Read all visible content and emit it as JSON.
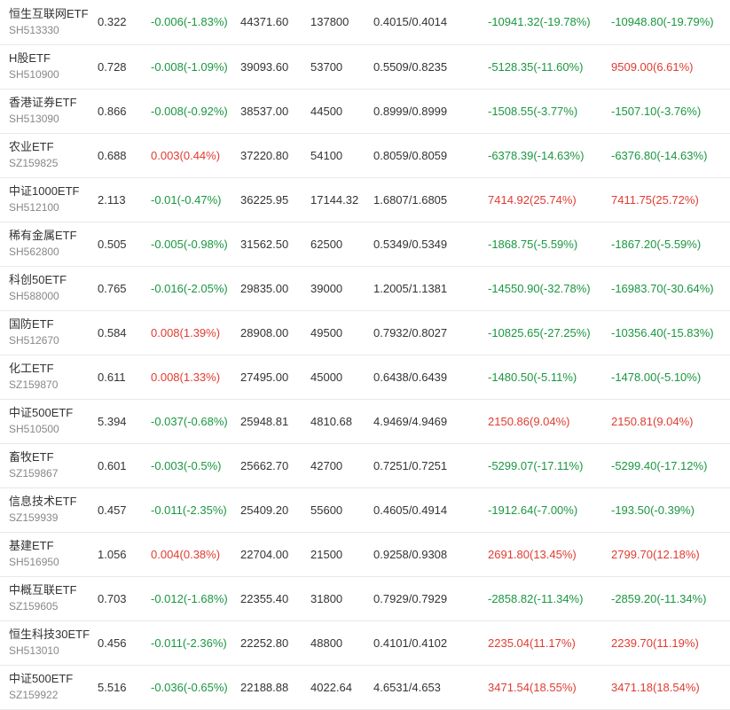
{
  "colors": {
    "up": "#e03c31",
    "down": "#1a9740",
    "neutral": "#333333",
    "code": "#888888"
  },
  "rows": [
    {
      "name": "恒生互联网ETF",
      "code": "SH513330",
      "price": "0.322",
      "change": "-0.006(-1.83%)",
      "amount": "44371.60",
      "volume": "137800",
      "range": "0.4015/0.4014",
      "profit": "-10941.32(-19.78%)",
      "profit2": "-10948.80(-19.79%)",
      "c_change": "down",
      "c_profit": "down",
      "c_profit2": "down"
    },
    {
      "name": "H股ETF",
      "code": "SH510900",
      "price": "0.728",
      "change": "-0.008(-1.09%)",
      "amount": "39093.60",
      "volume": "53700",
      "range": "0.5509/0.8235",
      "profit": "-5128.35(-11.60%)",
      "profit2": "9509.00(6.61%)",
      "c_change": "down",
      "c_profit": "down",
      "c_profit2": "up"
    },
    {
      "name": "香港证券ETF",
      "code": "SH513090",
      "price": "0.866",
      "change": "-0.008(-0.92%)",
      "amount": "38537.00",
      "volume": "44500",
      "range": "0.8999/0.8999",
      "profit": "-1508.55(-3.77%)",
      "profit2": "-1507.10(-3.76%)",
      "c_change": "down",
      "c_profit": "down",
      "c_profit2": "down"
    },
    {
      "name": "农业ETF",
      "code": "SZ159825",
      "price": "0.688",
      "change": "0.003(0.44%)",
      "amount": "37220.80",
      "volume": "54100",
      "range": "0.8059/0.8059",
      "profit": "-6378.39(-14.63%)",
      "profit2": "-6376.80(-14.63%)",
      "c_change": "up",
      "c_profit": "down",
      "c_profit2": "down"
    },
    {
      "name": "中证1000ETF",
      "code": "SH512100",
      "price": "2.113",
      "change": "-0.01(-0.47%)",
      "amount": "36225.95",
      "volume": "17144.32",
      "range": "1.6807/1.6805",
      "profit": "7414.92(25.74%)",
      "profit2": "7411.75(25.72%)",
      "c_change": "down",
      "c_profit": "up",
      "c_profit2": "up"
    },
    {
      "name": "稀有金属ETF",
      "code": "SH562800",
      "price": "0.505",
      "change": "-0.005(-0.98%)",
      "amount": "31562.50",
      "volume": "62500",
      "range": "0.5349/0.5349",
      "profit": "-1868.75(-5.59%)",
      "profit2": "-1867.20(-5.59%)",
      "c_change": "down",
      "c_profit": "down",
      "c_profit2": "down"
    },
    {
      "name": "科创50ETF",
      "code": "SH588000",
      "price": "0.765",
      "change": "-0.016(-2.05%)",
      "amount": "29835.00",
      "volume": "39000",
      "range": "1.2005/1.1381",
      "profit": "-14550.90(-32.78%)",
      "profit2": "-16983.70(-30.64%)",
      "c_change": "down",
      "c_profit": "down",
      "c_profit2": "down"
    },
    {
      "name": "国防ETF",
      "code": "SH512670",
      "price": "0.584",
      "change": "0.008(1.39%)",
      "amount": "28908.00",
      "volume": "49500",
      "range": "0.7932/0.8027",
      "profit": "-10825.65(-27.25%)",
      "profit2": "-10356.40(-15.83%)",
      "c_change": "up",
      "c_profit": "down",
      "c_profit2": "down"
    },
    {
      "name": "化工ETF",
      "code": "SZ159870",
      "price": "0.611",
      "change": "0.008(1.33%)",
      "amount": "27495.00",
      "volume": "45000",
      "range": "0.6438/0.6439",
      "profit": "-1480.50(-5.11%)",
      "profit2": "-1478.00(-5.10%)",
      "c_change": "up",
      "c_profit": "down",
      "c_profit2": "down"
    },
    {
      "name": "中证500ETF",
      "code": "SH510500",
      "price": "5.394",
      "change": "-0.037(-0.68%)",
      "amount": "25948.81",
      "volume": "4810.68",
      "range": "4.9469/4.9469",
      "profit": "2150.86(9.04%)",
      "profit2": "2150.81(9.04%)",
      "c_change": "down",
      "c_profit": "up",
      "c_profit2": "up"
    },
    {
      "name": "畜牧ETF",
      "code": "SZ159867",
      "price": "0.601",
      "change": "-0.003(-0.5%)",
      "amount": "25662.70",
      "volume": "42700",
      "range": "0.7251/0.7251",
      "profit": "-5299.07(-17.11%)",
      "profit2": "-5299.40(-17.12%)",
      "c_change": "down",
      "c_profit": "down",
      "c_profit2": "down"
    },
    {
      "name": "信息技术ETF",
      "code": "SZ159939",
      "price": "0.457",
      "change": "-0.011(-2.35%)",
      "amount": "25409.20",
      "volume": "55600",
      "range": "0.4605/0.4914",
      "profit": "-1912.64(-7.00%)",
      "profit2": "-193.50(-0.39%)",
      "c_change": "down",
      "c_profit": "down",
      "c_profit2": "down"
    },
    {
      "name": "基建ETF",
      "code": "SH516950",
      "price": "1.056",
      "change": "0.004(0.38%)",
      "amount": "22704.00",
      "volume": "21500",
      "range": "0.9258/0.9308",
      "profit": "2691.80(13.45%)",
      "profit2": "2799.70(12.18%)",
      "c_change": "up",
      "c_profit": "up",
      "c_profit2": "up"
    },
    {
      "name": "中概互联ETF",
      "code": "SZ159605",
      "price": "0.703",
      "change": "-0.012(-1.68%)",
      "amount": "22355.40",
      "volume": "31800",
      "range": "0.7929/0.7929",
      "profit": "-2858.82(-11.34%)",
      "profit2": "-2859.20(-11.34%)",
      "c_change": "down",
      "c_profit": "down",
      "c_profit2": "down"
    },
    {
      "name": "恒生科技30ETF",
      "code": "SH513010",
      "price": "0.456",
      "change": "-0.011(-2.36%)",
      "amount": "22252.80",
      "volume": "48800",
      "range": "0.4101/0.4102",
      "profit": "2235.04(11.17%)",
      "profit2": "2239.70(11.19%)",
      "c_change": "down",
      "c_profit": "up",
      "c_profit2": "up"
    },
    {
      "name": "中证500ETF",
      "code": "SZ159922",
      "price": "5.516",
      "change": "-0.036(-0.65%)",
      "amount": "22188.88",
      "volume": "4022.64",
      "range": "4.6531/4.653",
      "profit": "3471.54(18.55%)",
      "profit2": "3471.18(18.54%)",
      "c_change": "down",
      "c_profit": "up",
      "c_profit2": "up"
    }
  ]
}
